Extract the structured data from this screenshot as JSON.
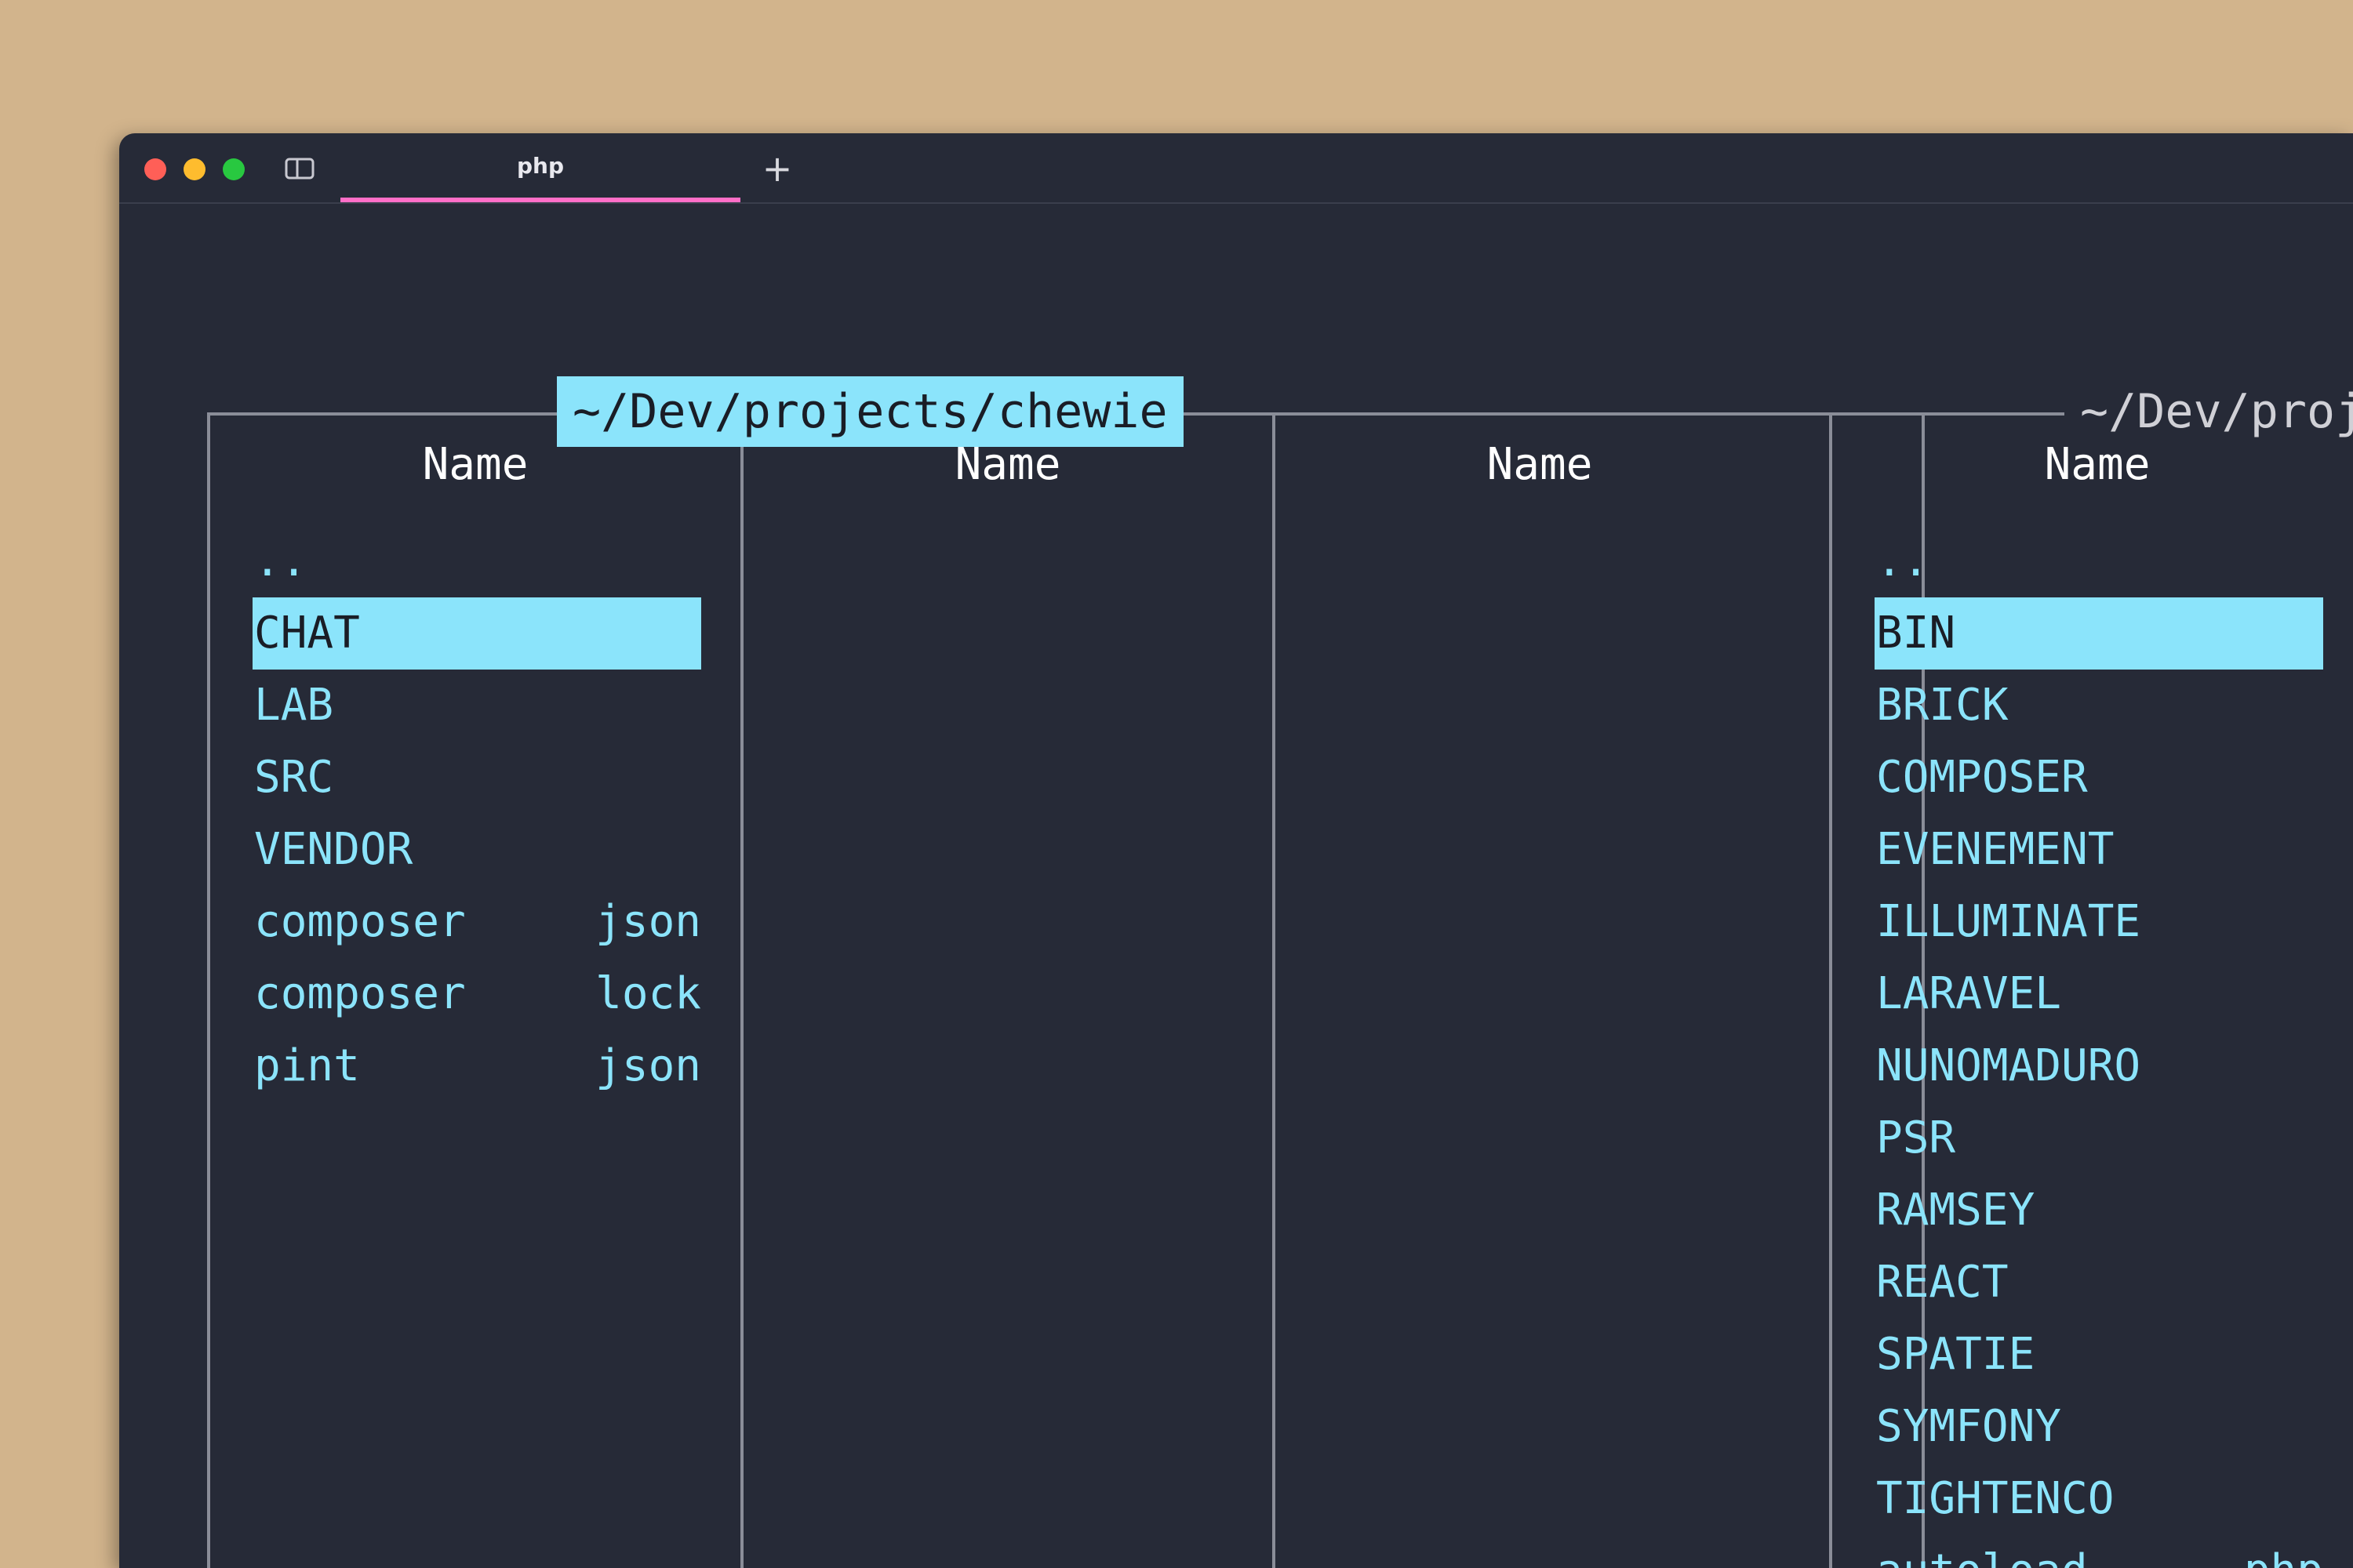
{
  "window": {
    "tab_label": "php",
    "new_tab_symbol": "+",
    "traffic_colors": {
      "close": "#ff5f57",
      "minimize": "#febc2e",
      "zoom": "#28c840"
    },
    "accent_tab_underline": "#ff6ec7",
    "background": "#262a37",
    "highlight": "#8be4fb",
    "icons": [
      "sidebar-toggle-icon",
      "plus-icon"
    ]
  },
  "left_pane": {
    "title": "~/Dev/projects/chewie",
    "columns": [
      "Name",
      "Name",
      "Name"
    ],
    "entries": [
      {
        "name": "..",
        "ext": ""
      },
      {
        "name": "CHAT",
        "ext": "",
        "selected": true
      },
      {
        "name": "LAB",
        "ext": ""
      },
      {
        "name": "SRC",
        "ext": ""
      },
      {
        "name": "VENDOR",
        "ext": ""
      },
      {
        "name": "composer",
        "ext": "json"
      },
      {
        "name": "composer",
        "ext": "lock"
      },
      {
        "name": "pint",
        "ext": "json"
      }
    ]
  },
  "right_pane": {
    "title": "~/Dev/proj",
    "column": "Name",
    "entries": [
      {
        "name": "..",
        "ext": ""
      },
      {
        "name": "BIN",
        "ext": "",
        "selected": true
      },
      {
        "name": "BRICK",
        "ext": ""
      },
      {
        "name": "COMPOSER",
        "ext": ""
      },
      {
        "name": "EVENEMENT",
        "ext": ""
      },
      {
        "name": "ILLUMINATE",
        "ext": ""
      },
      {
        "name": "LARAVEL",
        "ext": ""
      },
      {
        "name": "NUNOMADURO",
        "ext": ""
      },
      {
        "name": "PSR",
        "ext": ""
      },
      {
        "name": "RAMSEY",
        "ext": ""
      },
      {
        "name": "REACT",
        "ext": ""
      },
      {
        "name": "SPATIE",
        "ext": ""
      },
      {
        "name": "SYMFONY",
        "ext": ""
      },
      {
        "name": "TIGHTENCO",
        "ext": ""
      },
      {
        "name": "autoload",
        "ext": "php"
      }
    ]
  }
}
